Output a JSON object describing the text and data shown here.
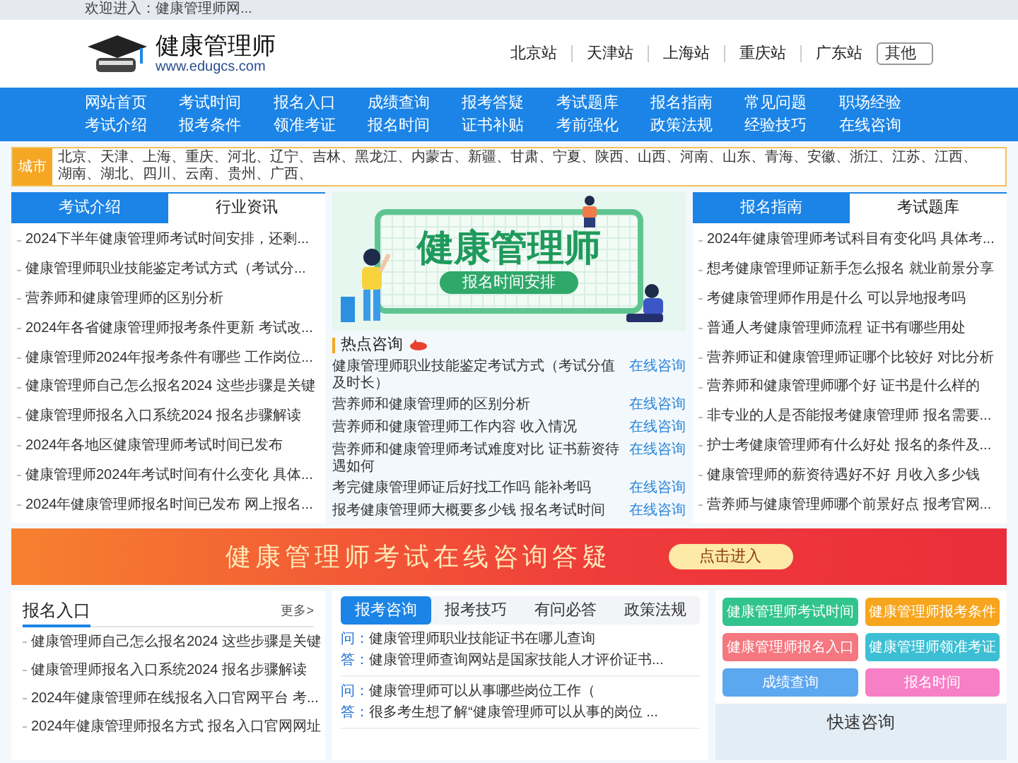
{
  "top_bar": {
    "welcome": "欢迎进入：健康管理师网..."
  },
  "header": {
    "logo_title": "健康管理师",
    "logo_url": "www.edugcs.com",
    "stations": [
      "北京站",
      "天津站",
      "上海站",
      "重庆站",
      "广东站"
    ],
    "other": "其他"
  },
  "nav": {
    "rows": [
      [
        "网站首页",
        "考试时间",
        "报名入口",
        "成绩查询",
        "报考答疑",
        "考试题库",
        "报名指南",
        "常见问题",
        "职场经验"
      ],
      [
        "考试介绍",
        "报考条件",
        "领准考证",
        "报名时间",
        "证书补贴",
        "考前强化",
        "政策法规",
        "经验技巧",
        "在线咨询"
      ]
    ]
  },
  "cities": {
    "label": "城市",
    "items": [
      "北京、",
      "天津、",
      "上海、",
      "重庆、",
      "河北、",
      "辽宁、",
      "吉林、",
      "黑龙江、",
      "内蒙古、",
      "新疆、",
      "甘肃、",
      "宁夏、",
      "陕西、",
      "山西、",
      "河南、",
      "山东、",
      "青海、",
      "安徽、",
      "浙江、",
      "江苏、",
      "江西、",
      "湖南、",
      "湖北、",
      "四川、",
      "云南、",
      "贵州、",
      "广西、"
    ]
  },
  "left_panel": {
    "tabs": [
      {
        "label": "考试介绍",
        "selected": true
      },
      {
        "label": "行业资讯",
        "selected": false
      }
    ],
    "items": [
      "2024下半年健康管理师考试时间安排，还剩...",
      "健康管理师职业技能鉴定考试方式（考试分...",
      "营养师和健康管理师的区别分析",
      "2024年各省健康管理师报考条件更新 考试改...",
      "健康管理师2024年报考条件有哪些 工作岗位...",
      "健康管理师自己怎么报名2024 这些步骤是关键",
      "健康管理师报名入口系统2024 报名步骤解读",
      "2024年各地区健康管理师考试时间已发布",
      "健康管理师2024年考试时间有什么变化 具体...",
      "2024年健康管理师报名时间已发布 网上报名..."
    ]
  },
  "feature": {
    "title": "健康管理师",
    "subtitle": "报名时间安排",
    "hot_heading": "热点咨询",
    "hot_items": [
      {
        "title": "健康管理师职业技能鉴定考试方式（考试分值及时长）",
        "action": "在线咨询"
      },
      {
        "title": "营养师和健康管理师的区别分析",
        "action": "在线咨询"
      },
      {
        "title": "营养师和健康管理师工作内容 收入情况",
        "action": "在线咨询"
      },
      {
        "title": "营养师和健康管理师考试难度对比 证书薪资待遇如何",
        "action": "在线咨询"
      },
      {
        "title": "考完健康管理师证后好找工作吗 能补考吗",
        "action": "在线咨询"
      },
      {
        "title": "报考健康管理师大概要多少钱 报名考试时间",
        "action": "在线咨询"
      }
    ]
  },
  "right_panel": {
    "tabs": [
      {
        "label": "报名指南",
        "selected": true
      },
      {
        "label": "考试题库",
        "selected": false
      }
    ],
    "items": [
      "2024年健康管理师考试科目有变化吗 具体考...",
      "想考健康管理师证新手怎么报名 就业前景分享",
      "考健康管理师作用是什么 可以异地报考吗",
      "普通人考健康管理师流程 证书有哪些用处",
      "营养师证和健康管理师证哪个比较好 对比分析",
      "营养师和健康管理师哪个好 证书是什么样的",
      "非专业的人是否能报考健康管理师 报名需要...",
      "护士考健康管理师有什么好处 报名的条件及...",
      "健康管理师的薪资待遇好不好 月收入多少钱",
      "营养师与健康管理师哪个前景好点 报考官网..."
    ]
  },
  "promo": {
    "text": "健康管理师考试在线咨询答疑",
    "button": "点击进入"
  },
  "signup": {
    "heading": "报名入口",
    "more": "更多>",
    "items": [
      "健康管理师自己怎么报名2024 这些步骤是关键",
      "健康管理师报名入口系统2024 报名步骤解读",
      "2024年健康管理师在线报名入口官网平台 考...",
      "2024年健康管理师报名方式 报名入口官网网址"
    ]
  },
  "qa": {
    "tabs": [
      {
        "label": "报考咨询",
        "selected": true
      },
      {
        "label": "报考技巧",
        "selected": false
      },
      {
        "label": "有问必答",
        "selected": false
      },
      {
        "label": "政策法规",
        "selected": false
      }
    ],
    "items": [
      {
        "q_mark": "问：",
        "question": "健康管理师职业技能证书在哪儿查询",
        "a_mark": "答：",
        "answer": "健康管理师查询网站是国家技能人才评价证书..."
      },
      {
        "q_mark": "问：",
        "question": "健康管理师可以从事哪些岗位工作（",
        "a_mark": "答：",
        "answer": "很多考生想了解“健康管理师可以从事的岗位 ..."
      }
    ]
  },
  "quick_links": [
    {
      "label": "健康管理师考试时间",
      "color": "#31c48d"
    },
    {
      "label": "健康管理师报考条件",
      "color": "#f7a51c"
    },
    {
      "label": "健康管理师报名入口",
      "color": "#f5777f"
    },
    {
      "label": "健康管理师领准考证",
      "color": "#3cbfd4"
    },
    {
      "label": "成绩查询",
      "color": "#5ba7f0"
    },
    {
      "label": "报名时间",
      "color": "#f77fc6"
    }
  ],
  "quick_consult": {
    "heading": "快速咨询"
  }
}
